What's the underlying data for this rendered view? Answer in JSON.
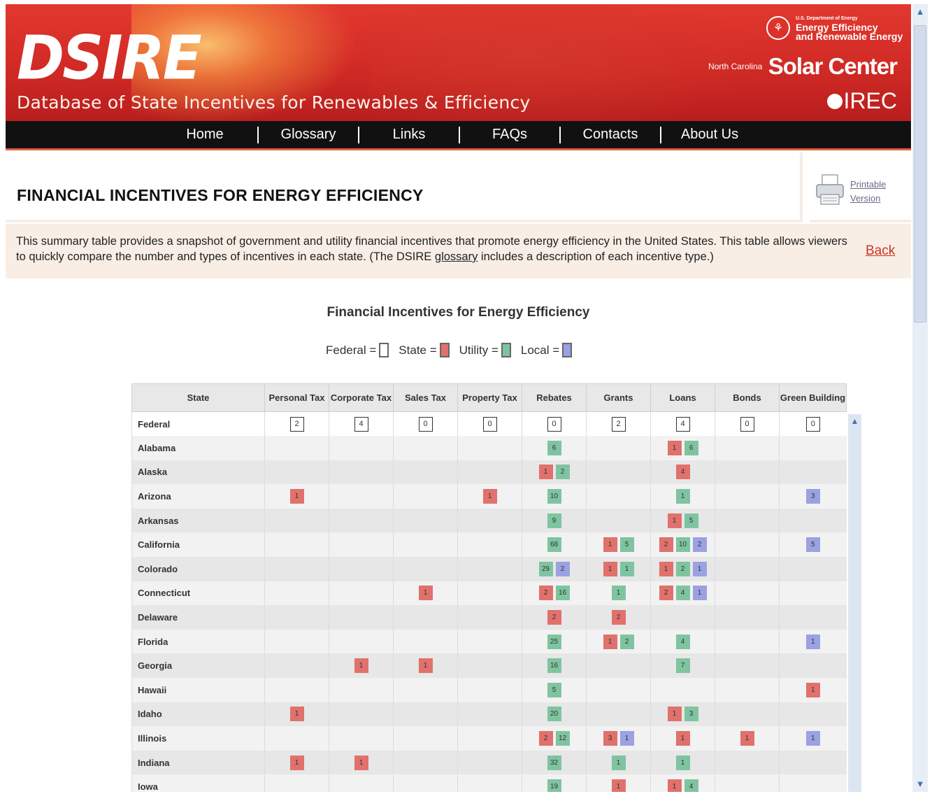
{
  "header": {
    "logo": "DSIRE",
    "subtitle": "Database of State Incentives for Renewables & Efficiency",
    "doe_line1": "U.S. Department of Energy",
    "doe_line2": "Energy Efficiency",
    "doe_line3": "and Renewable Energy",
    "nc": "North Carolina",
    "solar_center": "Solar Center",
    "irec": "IREC"
  },
  "nav": [
    "Home",
    "Glossary",
    "Links",
    "FAQs",
    "Contacts",
    "About Us"
  ],
  "page_title": "FINANCIAL INCENTIVES FOR ENERGY EFFICIENCY",
  "print": {
    "line1": "Printable",
    "line2": "Version"
  },
  "intro": {
    "text_before": "This summary table provides a snapshot of government and utility financial incentives that promote energy efficiency in the United States. This table allows viewers to quickly compare the number and types of incentives in each state. (The DSIRE ",
    "glossary": "glossary",
    "text_after": " includes a description of each incentive type.)",
    "back": "Back"
  },
  "table_title": "Financial Incentives for Energy Efficiency",
  "legend": [
    {
      "label": "Federal =",
      "color": "#ffffff"
    },
    {
      "label": "State =",
      "color": "#e0716c"
    },
    {
      "label": "Utility =",
      "color": "#7fc4a0"
    },
    {
      "label": "Local =",
      "color": "#9aa2e2"
    }
  ],
  "columns": [
    "State",
    "Personal Tax",
    "Corporate Tax",
    "Sales Tax",
    "Property Tax",
    "Rebates",
    "Grants",
    "Loans",
    "Bonds",
    "Green Building"
  ],
  "rows": [
    {
      "state": "Federal",
      "cells": [
        [
          [
            "F",
            "2"
          ]
        ],
        [
          [
            "F",
            "4"
          ]
        ],
        [
          [
            "F",
            "0"
          ]
        ],
        [
          [
            "F",
            "0"
          ]
        ],
        [
          [
            "F",
            "0"
          ]
        ],
        [
          [
            "F",
            "2"
          ]
        ],
        [
          [
            "F",
            "4"
          ]
        ],
        [
          [
            "F",
            "0"
          ]
        ],
        [
          [
            "F",
            "0"
          ]
        ]
      ]
    },
    {
      "state": "Alabama",
      "cells": [
        [],
        [],
        [],
        [],
        [
          [
            "U",
            "6"
          ]
        ],
        [],
        [
          [
            "S",
            "1"
          ],
          [
            "U",
            "6"
          ]
        ],
        [],
        []
      ]
    },
    {
      "state": "Alaska",
      "cells": [
        [],
        [],
        [],
        [],
        [
          [
            "S",
            "1"
          ],
          [
            "U",
            "2"
          ]
        ],
        [],
        [
          [
            "S",
            "4"
          ]
        ],
        [],
        []
      ]
    },
    {
      "state": "Arizona",
      "cells": [
        [
          [
            "S",
            "1"
          ]
        ],
        [],
        [],
        [
          [
            "S",
            "1"
          ]
        ],
        [
          [
            "U",
            "10"
          ]
        ],
        [],
        [
          [
            "U",
            "1"
          ]
        ],
        [],
        [
          [
            "L",
            "3"
          ]
        ]
      ]
    },
    {
      "state": "Arkansas",
      "cells": [
        [],
        [],
        [],
        [],
        [
          [
            "U",
            "9"
          ]
        ],
        [],
        [
          [
            "S",
            "1"
          ],
          [
            "U",
            "5"
          ]
        ],
        [],
        []
      ]
    },
    {
      "state": "California",
      "cells": [
        [],
        [],
        [],
        [],
        [
          [
            "U",
            "68"
          ]
        ],
        [
          [
            "S",
            "1"
          ],
          [
            "U",
            "5"
          ]
        ],
        [
          [
            "S",
            "2"
          ],
          [
            "U",
            "10"
          ],
          [
            "L",
            "2"
          ]
        ],
        [],
        [
          [
            "L",
            "5"
          ]
        ]
      ]
    },
    {
      "state": "Colorado",
      "cells": [
        [],
        [],
        [],
        [],
        [
          [
            "U",
            "29"
          ],
          [
            "L",
            "2"
          ]
        ],
        [
          [
            "S",
            "1"
          ],
          [
            "U",
            "1"
          ]
        ],
        [
          [
            "S",
            "1"
          ],
          [
            "U",
            "2"
          ],
          [
            "L",
            "1"
          ]
        ],
        [],
        []
      ]
    },
    {
      "state": "Connecticut",
      "cells": [
        [],
        [],
        [
          [
            "S",
            "1"
          ]
        ],
        [],
        [
          [
            "S",
            "2"
          ],
          [
            "U",
            "16"
          ]
        ],
        [
          [
            "U",
            "1"
          ]
        ],
        [
          [
            "S",
            "2"
          ],
          [
            "U",
            "4"
          ],
          [
            "L",
            "1"
          ]
        ],
        [],
        []
      ]
    },
    {
      "state": "Delaware",
      "cells": [
        [],
        [],
        [],
        [],
        [
          [
            "S",
            "2"
          ]
        ],
        [
          [
            "S",
            "2"
          ]
        ],
        [],
        [],
        []
      ]
    },
    {
      "state": "Florida",
      "cells": [
        [],
        [],
        [],
        [],
        [
          [
            "U",
            "25"
          ]
        ],
        [
          [
            "S",
            "1"
          ],
          [
            "U",
            "2"
          ]
        ],
        [
          [
            "U",
            "4"
          ]
        ],
        [],
        [
          [
            "L",
            "1"
          ]
        ]
      ]
    },
    {
      "state": "Georgia",
      "cells": [
        [],
        [
          [
            "S",
            "1"
          ]
        ],
        [
          [
            "S",
            "1"
          ]
        ],
        [],
        [
          [
            "U",
            "16"
          ]
        ],
        [],
        [
          [
            "U",
            "7"
          ]
        ],
        [],
        []
      ]
    },
    {
      "state": "Hawaii",
      "cells": [
        [],
        [],
        [],
        [],
        [
          [
            "U",
            "5"
          ]
        ],
        [],
        [],
        [],
        [
          [
            "S",
            "1"
          ]
        ]
      ]
    },
    {
      "state": "Idaho",
      "cells": [
        [
          [
            "S",
            "1"
          ]
        ],
        [],
        [],
        [],
        [
          [
            "U",
            "20"
          ]
        ],
        [],
        [
          [
            "S",
            "1"
          ],
          [
            "U",
            "3"
          ]
        ],
        [],
        []
      ]
    },
    {
      "state": "Illinois",
      "cells": [
        [],
        [],
        [],
        [],
        [
          [
            "S",
            "2"
          ],
          [
            "U",
            "12"
          ]
        ],
        [
          [
            "S",
            "3"
          ],
          [
            "L",
            "1"
          ]
        ],
        [
          [
            "S",
            "1"
          ]
        ],
        [
          [
            "S",
            "1"
          ]
        ],
        [
          [
            "L",
            "1"
          ]
        ]
      ]
    },
    {
      "state": "Indiana",
      "cells": [
        [
          [
            "S",
            "1"
          ]
        ],
        [
          [
            "S",
            "1"
          ]
        ],
        [],
        [],
        [
          [
            "U",
            "32"
          ]
        ],
        [
          [
            "U",
            "1"
          ]
        ],
        [
          [
            "U",
            "1"
          ]
        ],
        [],
        []
      ]
    },
    {
      "state": "Iowa",
      "cells": [
        [],
        [],
        [],
        [],
        [
          [
            "U",
            "19"
          ]
        ],
        [
          [
            "S",
            "1"
          ]
        ],
        [
          [
            "S",
            "1"
          ],
          [
            "U",
            "4"
          ]
        ],
        [],
        []
      ]
    }
  ]
}
